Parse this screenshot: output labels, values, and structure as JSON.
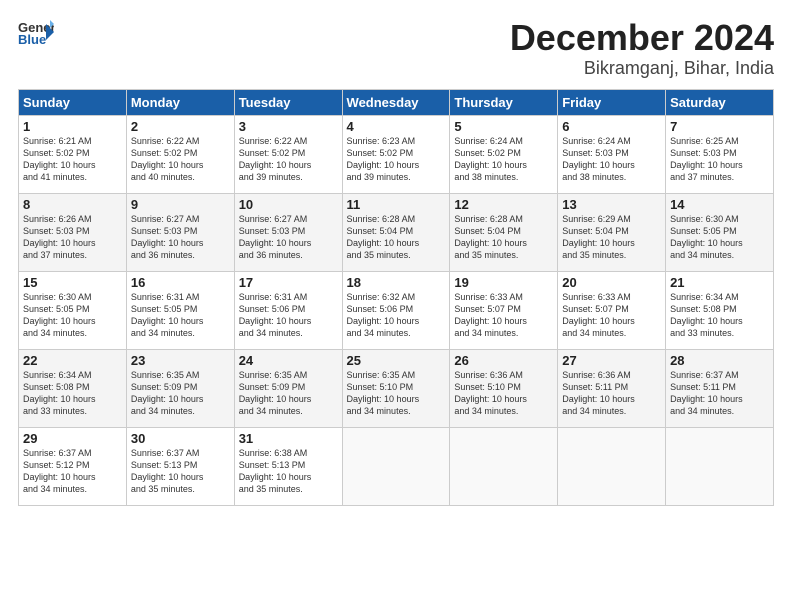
{
  "logo": {
    "general": "General",
    "blue": "Blue"
  },
  "title": {
    "month": "December 2024",
    "location": "Bikramganj, Bihar, India"
  },
  "headers": [
    "Sunday",
    "Monday",
    "Tuesday",
    "Wednesday",
    "Thursday",
    "Friday",
    "Saturday"
  ],
  "weeks": [
    [
      {
        "day": "1",
        "lines": [
          "Sunrise: 6:21 AM",
          "Sunset: 5:02 PM",
          "Daylight: 10 hours",
          "and 41 minutes."
        ]
      },
      {
        "day": "2",
        "lines": [
          "Sunrise: 6:22 AM",
          "Sunset: 5:02 PM",
          "Daylight: 10 hours",
          "and 40 minutes."
        ]
      },
      {
        "day": "3",
        "lines": [
          "Sunrise: 6:22 AM",
          "Sunset: 5:02 PM",
          "Daylight: 10 hours",
          "and 39 minutes."
        ]
      },
      {
        "day": "4",
        "lines": [
          "Sunrise: 6:23 AM",
          "Sunset: 5:02 PM",
          "Daylight: 10 hours",
          "and 39 minutes."
        ]
      },
      {
        "day": "5",
        "lines": [
          "Sunrise: 6:24 AM",
          "Sunset: 5:02 PM",
          "Daylight: 10 hours",
          "and 38 minutes."
        ]
      },
      {
        "day": "6",
        "lines": [
          "Sunrise: 6:24 AM",
          "Sunset: 5:03 PM",
          "Daylight: 10 hours",
          "and 38 minutes."
        ]
      },
      {
        "day": "7",
        "lines": [
          "Sunrise: 6:25 AM",
          "Sunset: 5:03 PM",
          "Daylight: 10 hours",
          "and 37 minutes."
        ]
      }
    ],
    [
      {
        "day": "8",
        "lines": [
          "Sunrise: 6:26 AM",
          "Sunset: 5:03 PM",
          "Daylight: 10 hours",
          "and 37 minutes."
        ]
      },
      {
        "day": "9",
        "lines": [
          "Sunrise: 6:27 AM",
          "Sunset: 5:03 PM",
          "Daylight: 10 hours",
          "and 36 minutes."
        ]
      },
      {
        "day": "10",
        "lines": [
          "Sunrise: 6:27 AM",
          "Sunset: 5:03 PM",
          "Daylight: 10 hours",
          "and 36 minutes."
        ]
      },
      {
        "day": "11",
        "lines": [
          "Sunrise: 6:28 AM",
          "Sunset: 5:04 PM",
          "Daylight: 10 hours",
          "and 35 minutes."
        ]
      },
      {
        "day": "12",
        "lines": [
          "Sunrise: 6:28 AM",
          "Sunset: 5:04 PM",
          "Daylight: 10 hours",
          "and 35 minutes."
        ]
      },
      {
        "day": "13",
        "lines": [
          "Sunrise: 6:29 AM",
          "Sunset: 5:04 PM",
          "Daylight: 10 hours",
          "and 35 minutes."
        ]
      },
      {
        "day": "14",
        "lines": [
          "Sunrise: 6:30 AM",
          "Sunset: 5:05 PM",
          "Daylight: 10 hours",
          "and 34 minutes."
        ]
      }
    ],
    [
      {
        "day": "15",
        "lines": [
          "Sunrise: 6:30 AM",
          "Sunset: 5:05 PM",
          "Daylight: 10 hours",
          "and 34 minutes."
        ]
      },
      {
        "day": "16",
        "lines": [
          "Sunrise: 6:31 AM",
          "Sunset: 5:05 PM",
          "Daylight: 10 hours",
          "and 34 minutes."
        ]
      },
      {
        "day": "17",
        "lines": [
          "Sunrise: 6:31 AM",
          "Sunset: 5:06 PM",
          "Daylight: 10 hours",
          "and 34 minutes."
        ]
      },
      {
        "day": "18",
        "lines": [
          "Sunrise: 6:32 AM",
          "Sunset: 5:06 PM",
          "Daylight: 10 hours",
          "and 34 minutes."
        ]
      },
      {
        "day": "19",
        "lines": [
          "Sunrise: 6:33 AM",
          "Sunset: 5:07 PM",
          "Daylight: 10 hours",
          "and 34 minutes."
        ]
      },
      {
        "day": "20",
        "lines": [
          "Sunrise: 6:33 AM",
          "Sunset: 5:07 PM",
          "Daylight: 10 hours",
          "and 34 minutes."
        ]
      },
      {
        "day": "21",
        "lines": [
          "Sunrise: 6:34 AM",
          "Sunset: 5:08 PM",
          "Daylight: 10 hours",
          "and 33 minutes."
        ]
      }
    ],
    [
      {
        "day": "22",
        "lines": [
          "Sunrise: 6:34 AM",
          "Sunset: 5:08 PM",
          "Daylight: 10 hours",
          "and 33 minutes."
        ]
      },
      {
        "day": "23",
        "lines": [
          "Sunrise: 6:35 AM",
          "Sunset: 5:09 PM",
          "Daylight: 10 hours",
          "and 34 minutes."
        ]
      },
      {
        "day": "24",
        "lines": [
          "Sunrise: 6:35 AM",
          "Sunset: 5:09 PM",
          "Daylight: 10 hours",
          "and 34 minutes."
        ]
      },
      {
        "day": "25",
        "lines": [
          "Sunrise: 6:35 AM",
          "Sunset: 5:10 PM",
          "Daylight: 10 hours",
          "and 34 minutes."
        ]
      },
      {
        "day": "26",
        "lines": [
          "Sunrise: 6:36 AM",
          "Sunset: 5:10 PM",
          "Daylight: 10 hours",
          "and 34 minutes."
        ]
      },
      {
        "day": "27",
        "lines": [
          "Sunrise: 6:36 AM",
          "Sunset: 5:11 PM",
          "Daylight: 10 hours",
          "and 34 minutes."
        ]
      },
      {
        "day": "28",
        "lines": [
          "Sunrise: 6:37 AM",
          "Sunset: 5:11 PM",
          "Daylight: 10 hours",
          "and 34 minutes."
        ]
      }
    ],
    [
      {
        "day": "29",
        "lines": [
          "Sunrise: 6:37 AM",
          "Sunset: 5:12 PM",
          "Daylight: 10 hours",
          "and 34 minutes."
        ]
      },
      {
        "day": "30",
        "lines": [
          "Sunrise: 6:37 AM",
          "Sunset: 5:13 PM",
          "Daylight: 10 hours",
          "and 35 minutes."
        ]
      },
      {
        "day": "31",
        "lines": [
          "Sunrise: 6:38 AM",
          "Sunset: 5:13 PM",
          "Daylight: 10 hours",
          "and 35 minutes."
        ]
      },
      {
        "day": "",
        "lines": []
      },
      {
        "day": "",
        "lines": []
      },
      {
        "day": "",
        "lines": []
      },
      {
        "day": "",
        "lines": []
      }
    ]
  ]
}
